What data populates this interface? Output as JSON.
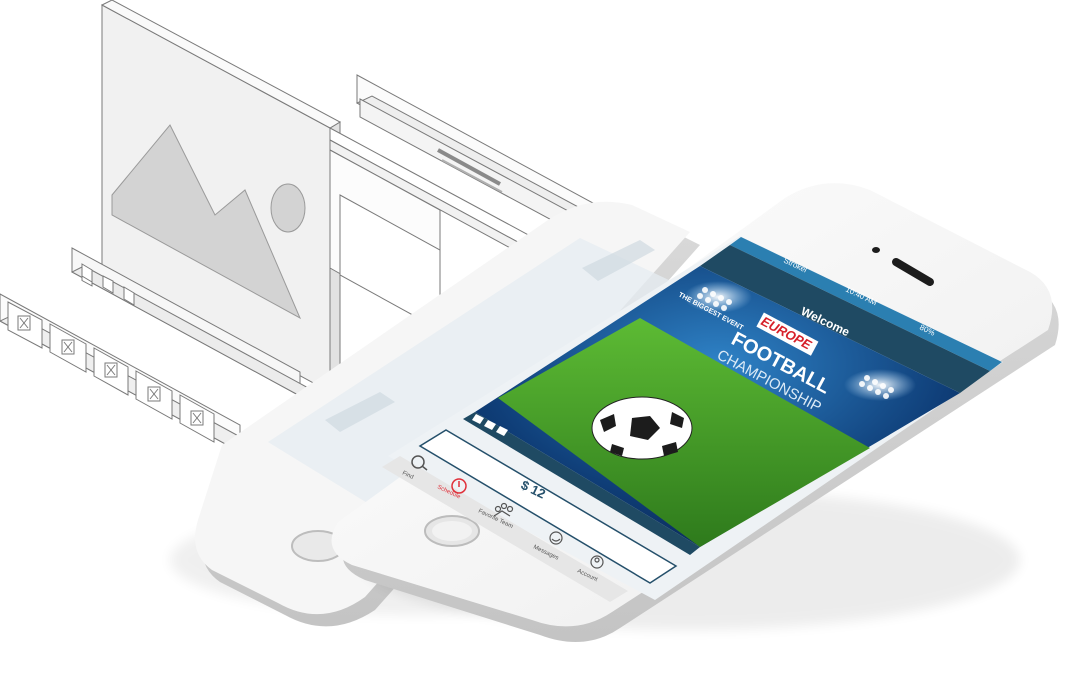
{
  "phone": {
    "status_bar": {
      "carrier": "Strokel",
      "time": "10:40 AM",
      "battery": "80%"
    },
    "header": {
      "title": "Welcome"
    },
    "banner": {
      "tag": "THE BIGGEST EVENT",
      "badge": "EUROPE",
      "title_line1": "FOOTBALL",
      "title_line2": "CHAMPIONSHIP"
    },
    "price": {
      "amount": "$ 12"
    },
    "bottom_nav": [
      {
        "label": "Find",
        "icon": "search-icon",
        "active": false
      },
      {
        "label": "Schedule",
        "icon": "clock-icon",
        "active": true
      },
      {
        "label": "Favorite Team",
        "icon": "team-icon",
        "active": false
      },
      {
        "label": "Messages",
        "icon": "smile-icon",
        "active": false
      },
      {
        "label": "Account",
        "icon": "account-icon",
        "active": false
      }
    ]
  },
  "colors": {
    "header_blue": "#2b7fb1",
    "header_dark": "#1f4a63",
    "price_blue": "#25506b",
    "schedule_red": "#e0303a",
    "field_green": "#3f9b2a"
  }
}
